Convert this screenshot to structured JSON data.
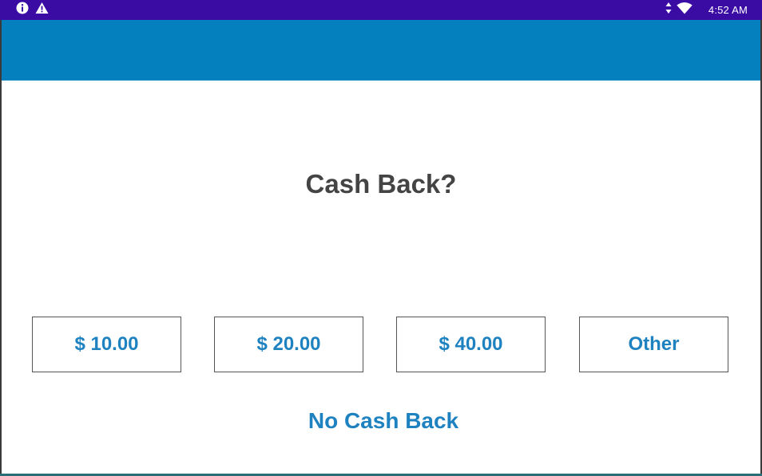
{
  "status_bar": {
    "time": "4:52 AM",
    "left_icons": [
      "info-icon",
      "warning-icon"
    ],
    "right_icons": [
      "data-arrows-icon",
      "wifi-icon"
    ],
    "background": "#3a0ca3"
  },
  "app_bar": {
    "background": "#0580bf"
  },
  "prompt": {
    "title": "Cash Back?"
  },
  "options": [
    {
      "label": "$ 10.00"
    },
    {
      "label": "$ 20.00"
    },
    {
      "label": "$ 40.00"
    },
    {
      "label": "Other"
    }
  ],
  "decline": {
    "label": "No Cash Back"
  },
  "colors": {
    "accent": "#1f82c0",
    "title_text": "#444444"
  }
}
